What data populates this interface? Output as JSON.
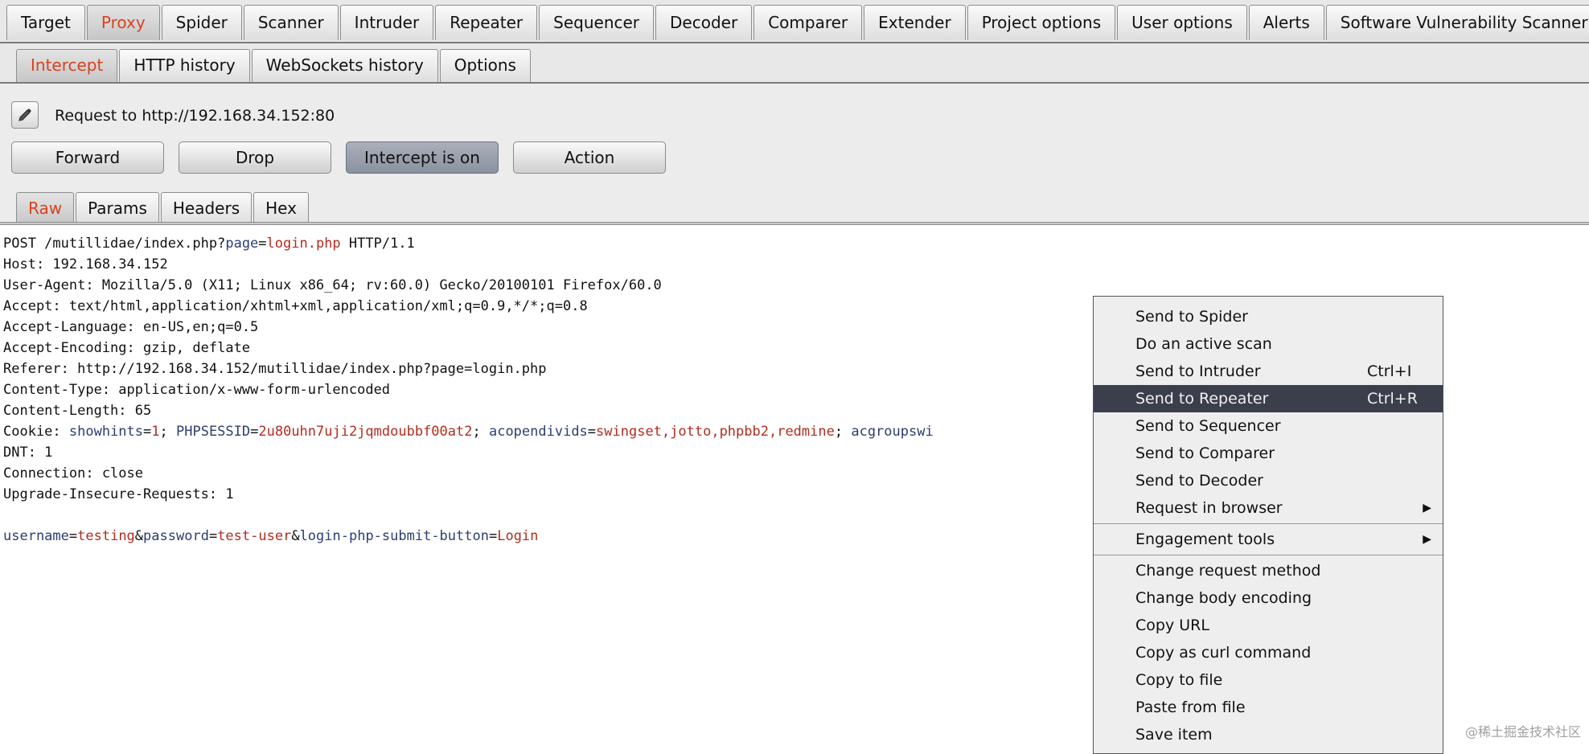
{
  "top_tabs": [
    {
      "label": "Target",
      "active": false
    },
    {
      "label": "Proxy",
      "active": true
    },
    {
      "label": "Spider",
      "active": false
    },
    {
      "label": "Scanner",
      "active": false
    },
    {
      "label": "Intruder",
      "active": false
    },
    {
      "label": "Repeater",
      "active": false
    },
    {
      "label": "Sequencer",
      "active": false
    },
    {
      "label": "Decoder",
      "active": false
    },
    {
      "label": "Comparer",
      "active": false
    },
    {
      "label": "Extender",
      "active": false
    },
    {
      "label": "Project options",
      "active": false
    },
    {
      "label": "User options",
      "active": false
    },
    {
      "label": "Alerts",
      "active": false
    },
    {
      "label": "Software Vulnerability Scanner",
      "active": false
    }
  ],
  "proxy_tabs": [
    {
      "label": "Intercept",
      "active": true
    },
    {
      "label": "HTTP history",
      "active": false
    },
    {
      "label": "WebSockets history",
      "active": false
    },
    {
      "label": "Options",
      "active": false
    }
  ],
  "intercept": {
    "edit_icon": "pencil-icon",
    "request_label": "Request to http://192.168.34.152:80",
    "buttons": {
      "forward": "Forward",
      "drop": "Drop",
      "intercept": "Intercept is on",
      "action": "Action"
    }
  },
  "view_tabs": [
    {
      "label": "Raw",
      "active": true
    },
    {
      "label": "Params",
      "active": false
    },
    {
      "label": "Headers",
      "active": false
    },
    {
      "label": "Hex",
      "active": false
    }
  ],
  "request": {
    "lines": [
      [
        {
          "t": "POST /mutillidae/index.php?",
          "c": ""
        },
        {
          "t": "page",
          "c": "k"
        },
        {
          "t": "=",
          "c": ""
        },
        {
          "t": "login.php",
          "c": "v"
        },
        {
          "t": " HTTP/1.1",
          "c": ""
        }
      ],
      [
        {
          "t": "Host: 192.168.34.152",
          "c": ""
        }
      ],
      [
        {
          "t": "User-Agent: Mozilla/5.0 (X11; Linux x86_64; rv:60.0) Gecko/20100101 Firefox/60.0",
          "c": ""
        }
      ],
      [
        {
          "t": "Accept: text/html,application/xhtml+xml,application/xml;q=0.9,*/*;q=0.8",
          "c": ""
        }
      ],
      [
        {
          "t": "Accept-Language: en-US,en;q=0.5",
          "c": ""
        }
      ],
      [
        {
          "t": "Accept-Encoding: gzip, deflate",
          "c": ""
        }
      ],
      [
        {
          "t": "Referer: http://192.168.34.152/mutillidae/index.php?page=login.php",
          "c": ""
        }
      ],
      [
        {
          "t": "Content-Type: application/x-www-form-urlencoded",
          "c": ""
        }
      ],
      [
        {
          "t": "Content-Length: 65",
          "c": ""
        }
      ],
      [
        {
          "t": "Cookie: ",
          "c": ""
        },
        {
          "t": "showhints",
          "c": "k"
        },
        {
          "t": "=",
          "c": ""
        },
        {
          "t": "1",
          "c": "v"
        },
        {
          "t": "; ",
          "c": ""
        },
        {
          "t": "PHPSESSID",
          "c": "k"
        },
        {
          "t": "=",
          "c": ""
        },
        {
          "t": "2u80uhn7uji2jqmdoubbf00at2",
          "c": "v"
        },
        {
          "t": "; ",
          "c": ""
        },
        {
          "t": "acopendivids",
          "c": "k"
        },
        {
          "t": "=",
          "c": ""
        },
        {
          "t": "swingset,jotto,phpbb2,redmine",
          "c": "v"
        },
        {
          "t": "; ",
          "c": ""
        },
        {
          "t": "acgroupswi",
          "c": "k"
        }
      ],
      [
        {
          "t": "DNT: 1",
          "c": ""
        }
      ],
      [
        {
          "t": "Connection: close",
          "c": ""
        }
      ],
      [
        {
          "t": "Upgrade-Insecure-Requests: 1",
          "c": ""
        }
      ],
      [],
      [
        {
          "t": "username",
          "c": "k"
        },
        {
          "t": "=",
          "c": ""
        },
        {
          "t": "testing",
          "c": "v"
        },
        {
          "t": "&",
          "c": ""
        },
        {
          "t": "password",
          "c": "k"
        },
        {
          "t": "=",
          "c": ""
        },
        {
          "t": "test-user",
          "c": "v"
        },
        {
          "t": "&",
          "c": ""
        },
        {
          "t": "login-php-submit-button",
          "c": "k"
        },
        {
          "t": "=",
          "c": ""
        },
        {
          "t": "Login",
          "c": "v"
        }
      ]
    ]
  },
  "context_menu": {
    "groups": [
      [
        {
          "label": "Send to Spider",
          "shortcut": "",
          "submenu": false,
          "highlighted": false
        },
        {
          "label": "Do an active scan",
          "shortcut": "",
          "submenu": false,
          "highlighted": false
        },
        {
          "label": "Send to Intruder",
          "shortcut": "Ctrl+I",
          "submenu": false,
          "highlighted": false
        },
        {
          "label": "Send to Repeater",
          "shortcut": "Ctrl+R",
          "submenu": false,
          "highlighted": true
        },
        {
          "label": "Send to Sequencer",
          "shortcut": "",
          "submenu": false,
          "highlighted": false
        },
        {
          "label": "Send to Comparer",
          "shortcut": "",
          "submenu": false,
          "highlighted": false
        },
        {
          "label": "Send to Decoder",
          "shortcut": "",
          "submenu": false,
          "highlighted": false
        },
        {
          "label": "Request in browser",
          "shortcut": "",
          "submenu": true,
          "highlighted": false
        }
      ],
      [
        {
          "label": "Engagement tools",
          "shortcut": "",
          "submenu": true,
          "highlighted": false
        }
      ],
      [
        {
          "label": "Change request method",
          "shortcut": "",
          "submenu": false,
          "highlighted": false
        },
        {
          "label": "Change body encoding",
          "shortcut": "",
          "submenu": false,
          "highlighted": false
        },
        {
          "label": "Copy URL",
          "shortcut": "",
          "submenu": false,
          "highlighted": false
        },
        {
          "label": "Copy as curl command",
          "shortcut": "",
          "submenu": false,
          "highlighted": false
        },
        {
          "label": "Copy to file",
          "shortcut": "",
          "submenu": false,
          "highlighted": false
        },
        {
          "label": "Paste from file",
          "shortcut": "",
          "submenu": false,
          "highlighted": false
        },
        {
          "label": "Save item",
          "shortcut": "",
          "submenu": false,
          "highlighted": false
        }
      ]
    ]
  },
  "watermark": "@稀土掘金技术社区",
  "colors": {
    "param_name": "#2c3e72",
    "param_value": "#b32d1f",
    "active_tab_text": "#d9421f",
    "menu_highlight": "#3b3f4c"
  }
}
